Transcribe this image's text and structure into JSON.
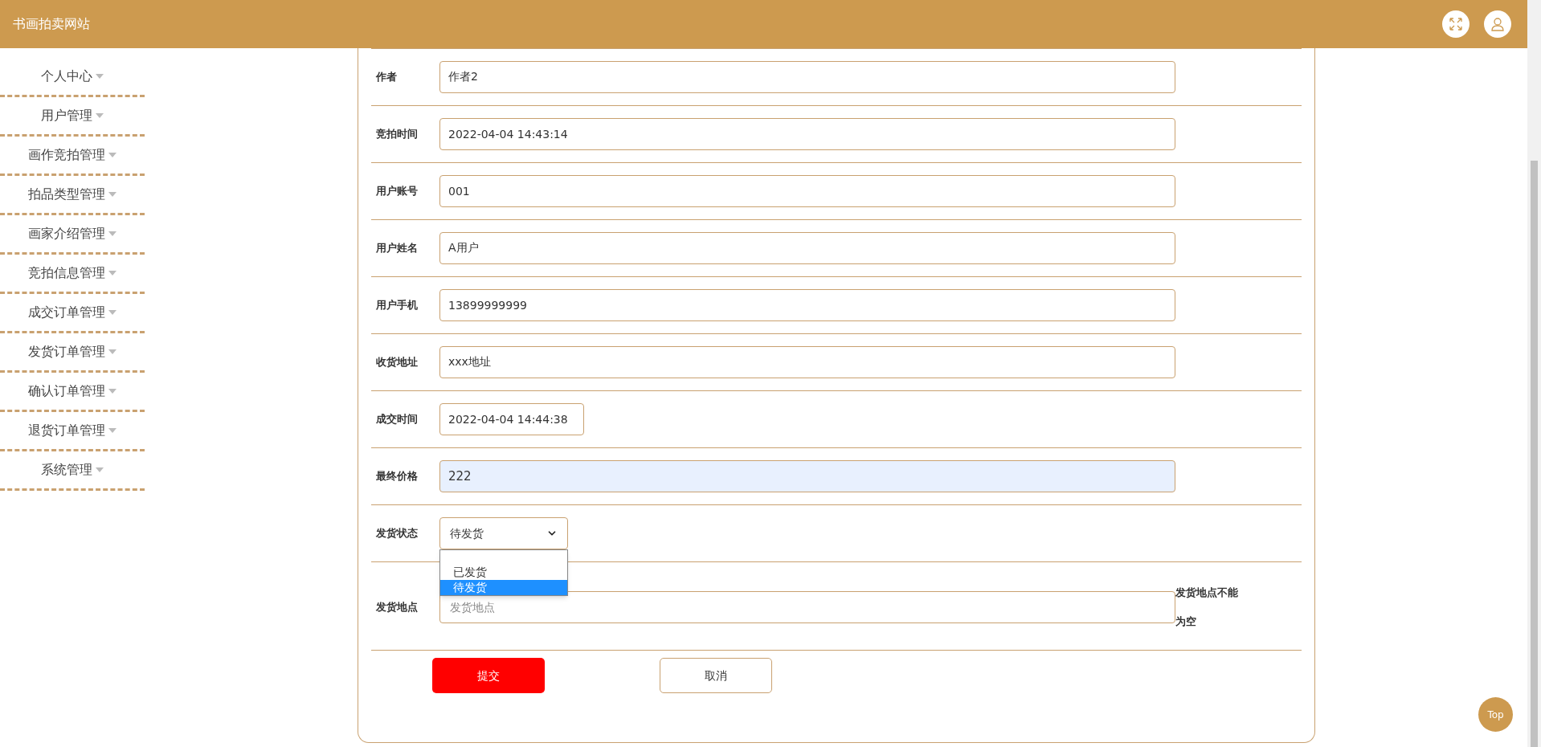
{
  "header": {
    "title": "书画拍卖网站"
  },
  "sidebar": {
    "items": [
      {
        "label": "个人中心"
      },
      {
        "label": "用户管理"
      },
      {
        "label": "画作竞拍管理"
      },
      {
        "label": "拍品类型管理"
      },
      {
        "label": "画家介绍管理"
      },
      {
        "label": "竞拍信息管理"
      },
      {
        "label": "成交订单管理"
      },
      {
        "label": "发货订单管理"
      },
      {
        "label": "确认订单管理"
      },
      {
        "label": "退货订单管理"
      },
      {
        "label": "系统管理"
      }
    ]
  },
  "form": {
    "fields": [
      {
        "kind": "text",
        "label": "作者",
        "value": "作者2",
        "autofilled": false
      },
      {
        "kind": "text",
        "label": "竞拍时间",
        "value": "2022-04-04 14:43:14",
        "autofilled": false
      },
      {
        "kind": "text",
        "label": "用户账号",
        "value": "001",
        "autofilled": false
      },
      {
        "kind": "text",
        "label": "用户姓名",
        "value": "A用户",
        "autofilled": false
      },
      {
        "kind": "text",
        "label": "用户手机",
        "value": "13899999999",
        "autofilled": false
      },
      {
        "kind": "text",
        "label": "收货地址",
        "value": "xxx地址",
        "autofilled": false
      },
      {
        "kind": "short",
        "label": "成交时间",
        "value": "2022-04-04 14:44:38",
        "autofilled": false
      },
      {
        "kind": "text",
        "label": "最终价格",
        "value": "222",
        "autofilled": true
      },
      {
        "kind": "select",
        "label": "发货状态",
        "value": "待发货",
        "expanded": true,
        "options": [
          {
            "label": "已发货",
            "selected": false
          },
          {
            "label": "待发货",
            "selected": true
          }
        ]
      },
      {
        "kind": "error",
        "label": "发货地点",
        "placeholder": "发货地点",
        "error": "发货地点不能为空"
      }
    ],
    "buttons": [
      {
        "kind": "primary",
        "label": "提交"
      },
      {
        "kind": "secondary",
        "label": "取消"
      }
    ]
  },
  "top_button": {
    "label": "Top"
  }
}
